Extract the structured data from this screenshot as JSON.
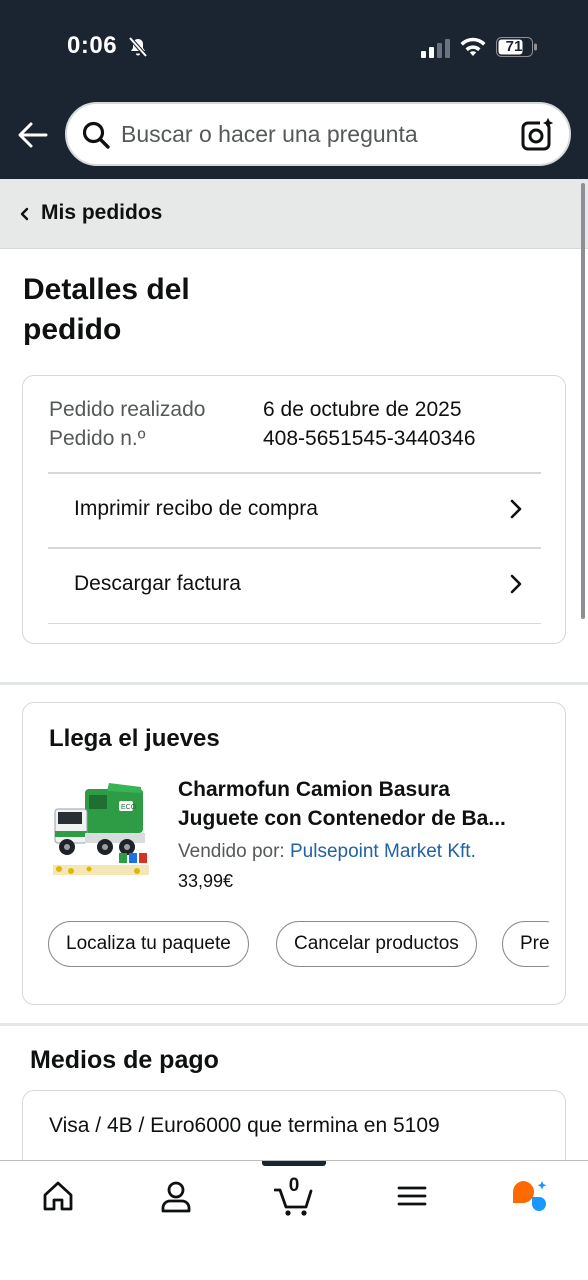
{
  "status_bar": {
    "time": "0:06",
    "battery": "71"
  },
  "header": {
    "search_placeholder": "Buscar o hacer una pregunta"
  },
  "breadcrumb": {
    "label": "Mis pedidos"
  },
  "page": {
    "title": "Detalles del pedido"
  },
  "order": {
    "placed_label": "Pedido realizado",
    "placed_value": "6 de octubre de 2025",
    "number_label": "Pedido n.º",
    "number_value": "408-5651545-3440346",
    "links": [
      {
        "label": "Imprimir recibo de compra"
      },
      {
        "label": "Descargar factura"
      }
    ]
  },
  "shipment": {
    "title": "Llega el jueves",
    "product": {
      "title_line1": "Charmofun Camion Basura",
      "title_line2": "Juguete con Contenedor de Ba...",
      "seller_prefix": "Vendido por:",
      "seller_name": "Pulsepoint Market Kft.",
      "price": "33,99€"
    },
    "actions": [
      {
        "label": "Localiza tu paquete"
      },
      {
        "label": "Cancelar productos"
      },
      {
        "label": "Pre"
      }
    ]
  },
  "payment": {
    "title": "Medios de pago",
    "method": "Visa / 4B / Euro6000  que termina en 5109"
  },
  "bottom_nav": {
    "items": [
      {
        "icon": "home-icon"
      },
      {
        "icon": "account-icon"
      },
      {
        "icon": "cart-icon",
        "count": "0"
      },
      {
        "icon": "menu-icon"
      },
      {
        "icon": "rufus-assistant-icon"
      }
    ],
    "colors": {
      "rufus_orange": "#ff6a00",
      "rufus_blue": "#1a98ff"
    }
  },
  "colors": {
    "header_bg": "#1b2431",
    "link": "#2162a1",
    "breadcrumb_bg": "#e7e9e9"
  }
}
